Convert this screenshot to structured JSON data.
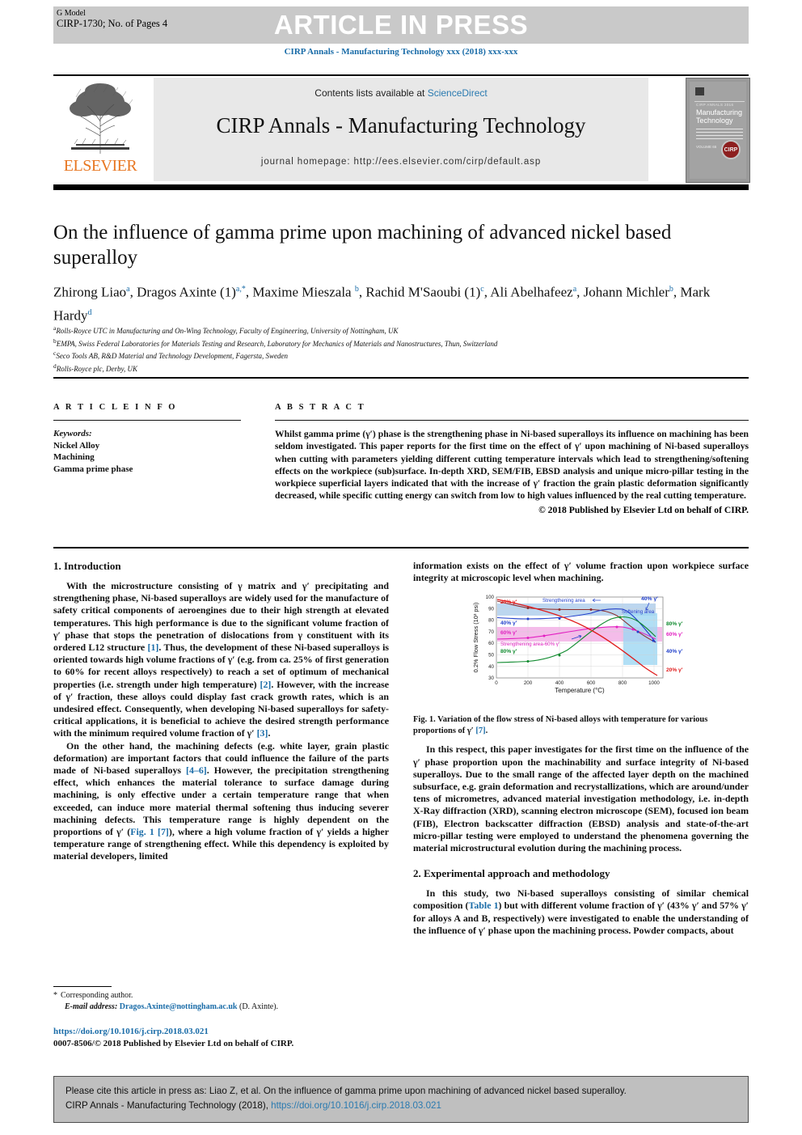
{
  "banner": {
    "g_model": "G Model",
    "article_id": "CIRP-1730; No. of Pages 4",
    "article_in_press": "ARTICLE IN PRESS",
    "journal_ref": "CIRP Annals - Manufacturing Technology xxx (2018) xxx-xxx"
  },
  "masthead": {
    "contents_prefix": "Contents lists available at ",
    "contents_link": "ScienceDirect",
    "journal_title": "CIRP Annals - Manufacturing Technology",
    "homepage": "journal homepage: http://ees.elsevier.com/cirp/default.asp",
    "publisher": "ELSEVIER",
    "cover": {
      "series": "CIRP ANNALS 2016",
      "title_line1": "Manufacturing",
      "title_line2": "Technology",
      "volume": "VOLUME 65",
      "logo": "CIRP"
    }
  },
  "article": {
    "title": "On the influence of gamma prime upon machining of advanced nickel based superalloy",
    "authors_html": "Zhirong Liao<sup>a</sup>, Dragos Axinte (1)<sup>a,*</sup>, Maxime Mieszala <sup>b</sup>, Rachid M'Saoubi (1)<sup>c</sup>, Ali Abelhafeez<sup>a</sup>, Johann Michler<sup>b</sup>, Mark Hardy<sup>d</sup>",
    "affiliations": [
      {
        "mark": "a",
        "text": "Rolls-Royce UTC in Manufacturing and On-Wing Technology, Faculty of Engineering, University of Nottingham, UK"
      },
      {
        "mark": "b",
        "text": "EMPA, Swiss Federal Laboratories for Materials Testing and Research, Laboratory for Mechanics of Materials and Nanostructures, Thun, Switzerland"
      },
      {
        "mark": "c",
        "text": "Seco Tools AB, R&D Material and Technology Development, Fagersta, Sweden"
      },
      {
        "mark": "d",
        "text": "Rolls-Royce plc, Derby, UK"
      }
    ]
  },
  "article_info": {
    "heading": "A R T I C L E   I N F O",
    "keywords_label": "Keywords:",
    "keywords": [
      "Nickel Alloy",
      "Machining",
      "Gamma prime phase"
    ]
  },
  "abstract": {
    "heading": "A B S T R A C T",
    "text": "Whilst gamma prime (γ′) phase is the strengthening phase in Ni-based superalloys its influence on machining has been seldom investigated. This paper reports for the first time on the effect of γ′ upon machining of Ni-based superalloys when cutting with parameters yielding different cutting temperature intervals which lead to strengthening/softening effects on the workpiece (sub)surface. In-depth XRD, SEM/FIB, EBSD analysis and unique micro-pillar testing in the workpiece superficial layers indicated that with the increase of γ′ fraction the grain plastic deformation significantly decreased, while specific cutting energy can switch from low to high values influenced by the real cutting temperature.",
    "copyright": "© 2018 Published by Elsevier Ltd on behalf of CIRP."
  },
  "sections": {
    "intro_heading": "1. Introduction",
    "intro_p1_a": "With the microstructure consisting of γ matrix and γ′ precipitating and strengthening phase, Ni-based superalloys are widely used for the manufacture of safety critical components of aeroengines due to their high strength at elevated temperatures. This high performance is due to the significant volume fraction of γ′ phase that stops the penetration of dislocations from γ constituent with its ordered L12 structure ",
    "intro_p1_ref1": "[1]",
    "intro_p1_b": ". Thus, the development of these Ni-based superalloys is oriented towards high volume fractions of γ′ (e.g. from ca. 25% of first generation to 60% for recent alloys respectively) to reach a set of optimum of mechanical properties (i.e. strength under high temperature) ",
    "intro_p1_ref2": "[2]",
    "intro_p1_c": ". However, with the increase of γ′ fraction, these alloys could display fast crack growth rates, which is an undesired effect. Consequently, when developing Ni-based superalloys for safety-critical applications, it is beneficial to achieve the desired strength performance with the minimum required volume fraction of γ′ ",
    "intro_p1_ref3": "[3]",
    "intro_p1_d": ".",
    "intro_p2_a": "On the other hand, the machining defects (e.g. white layer, grain plastic deformation) are important factors that could influence the failure of the parts made of Ni-based superalloys ",
    "intro_p2_ref1": "[4–6]",
    "intro_p2_b": ". However, the precipitation strengthening effect, which enhances the material tolerance to surface damage during machining, is only effective under a certain temperature range that when exceeded, can induce more material thermal softening thus inducing severer machining defects. This temperature range is highly dependent on the proportions of γ′ (",
    "intro_p2_ref2": "Fig. 1 [7]",
    "intro_p2_c": "), where a high volume fraction of γ′ yields a higher temperature range of strengthening effect. While this dependency is exploited by material developers, limited",
    "right_cont": "information exists on the effect of γ′ volume fraction upon workpiece surface integrity at microscopic level when machining.",
    "fig1_caption_a": "Fig. 1. ",
    "fig1_caption_b": "Variation of the flow stress of Ni-based alloys with temperature for various proportions of γ′ ",
    "fig1_caption_ref": "[7]",
    "fig1_caption_c": ".",
    "respect_p": "In this respect, this paper investigates for the first time on the influence of the γ′ phase proportion upon the machinability and surface integrity of Ni-based superalloys. Due to the small range of the affected layer depth on the machined subsurface, e.g. grain deformation and recrystallizations, which are around/under tens of micrometres, advanced material investigation methodology, i.e. in-depth X-Ray diffraction (XRD), scanning electron microscope (SEM), focused ion beam (FIB), Electron backscatter diffraction (EBSD) analysis and state-of-the-art micro-pillar testing were employed to understand the phenomena governing the material microstructural evolution during the machining process.",
    "exp_heading": "2. Experimental approach and methodology",
    "exp_p_a": "In this study, two Ni-based superalloys consisting of similar chemical composition (",
    "exp_p_ref": "Table 1",
    "exp_p_b": ") but with different volume fraction of γ′ (43% γ′ and 57% γ′ for alloys A and B, respectively) were investigated to enable the understanding of the influence of γ′ phase upon the machining process. Powder compacts, about"
  },
  "footnote": {
    "star": "*",
    "corresponding": "Corresponding author.",
    "email_label": "E-mail address:",
    "email": "Dragos.Axinte@nottingham.ac.uk",
    "email_suffix": "(D. Axinte).",
    "doi": "https://doi.org/10.1016/j.cirp.2018.03.021",
    "issn_line": "0007-8506/© 2018 Published by Elsevier Ltd on behalf of CIRP."
  },
  "cite_box": {
    "line1": "Please cite this article in press as: Liao Z, et al. On the influence of gamma prime upon machining of advanced nickel based superalloy.",
    "line2_prefix": "CIRP Annals - Manufacturing Technology (2018), ",
    "line2_link": "https://doi.org/10.1016/j.cirp.2018.03.021"
  },
  "colors": {
    "link": "#1a6ca8",
    "elsevier_orange": "#e87722",
    "banner_grey": "#c9c9c9",
    "cite_grey": "#bfbfbf"
  },
  "chart_data": {
    "type": "line",
    "title": "",
    "xlabel": "Temperature (°C)",
    "ylabel": "0.2% Flow Stress (10³ psi)",
    "xlim": [
      0,
      1050
    ],
    "ylim": [
      30,
      100
    ],
    "xticks": [
      0,
      200,
      400,
      600,
      800,
      1000
    ],
    "yticks": [
      30,
      40,
      50,
      60,
      70,
      80,
      90,
      100
    ],
    "grid": true,
    "legend_position": "right-inline",
    "annotations": [
      {
        "text": "20% γ′",
        "color": "#e01b1b",
        "role": "curve-label-left"
      },
      {
        "text": "40% γ′",
        "color": "#1f3ecb",
        "role": "curve-label-left"
      },
      {
        "text": "60% γ′",
        "color": "#e21fc1",
        "role": "curve-label-left"
      },
      {
        "text": "80% γ′",
        "color": "#0f8a2e",
        "role": "curve-label-left"
      },
      {
        "text": "Strengthening area",
        "color": "#1f3ecb",
        "role": "band-label"
      },
      {
        "text": "Softening area",
        "color": "#1f3ecb",
        "role": "band-label"
      },
      {
        "text": "Strengthening area-60% γ′",
        "color": "#e21fc1",
        "role": "band-label"
      },
      {
        "text": "40% γ′",
        "color": "#1f3ecb",
        "role": "arrow-label"
      }
    ],
    "right_labels": [
      {
        "text": "80% γ′",
        "color": "#0f8a2e"
      },
      {
        "text": "60% γ′",
        "color": "#e21fc1"
      },
      {
        "text": "40% γ′",
        "color": "#1f3ecb"
      },
      {
        "text": "20% γ′",
        "color": "#e01b1b"
      }
    ],
    "series": [
      {
        "name": "20% γ′",
        "color": "#8c2b2b",
        "x": [
          0,
          100,
          200,
          300,
          400,
          500,
          600,
          700,
          800,
          900,
          1000
        ],
        "y": [
          96,
          92,
          89,
          88,
          88,
          88,
          88,
          86,
          78,
          66,
          58
        ]
      },
      {
        "name": "40% γ′",
        "color": "#1f3ecb",
        "x": [
          0,
          100,
          200,
          300,
          400,
          500,
          600,
          700,
          800,
          900,
          1000
        ],
        "y": [
          82,
          81,
          81,
          80,
          81,
          81,
          84,
          88,
          87,
          70,
          52
        ]
      },
      {
        "name": "60% γ′",
        "color": "#e21fc1",
        "x": [
          0,
          100,
          200,
          300,
          400,
          500,
          600,
          700,
          800,
          900,
          1000
        ],
        "y": [
          63,
          64,
          64,
          65,
          66,
          68,
          70,
          72,
          74,
          72,
          64
        ]
      },
      {
        "name": "80% γ′",
        "color": "#0f8a2e",
        "x": [
          0,
          100,
          200,
          300,
          400,
          500,
          600,
          700,
          800,
          900,
          1000
        ],
        "y": [
          43,
          44,
          44,
          45,
          46,
          49,
          56,
          68,
          79,
          80,
          70
        ]
      },
      {
        "name": "20% γ′ falling",
        "color": "#e01b1b",
        "x": [
          0,
          200,
          400,
          600,
          700,
          800,
          900,
          1000
        ],
        "y": [
          99,
          95,
          90,
          83,
          76,
          64,
          48,
          33
        ]
      }
    ],
    "bands": [
      {
        "label": "Strengthening area (blue)",
        "color": "#bcd6ef",
        "x_range": [
          30,
          880
        ],
        "y_range": [
          80,
          90
        ]
      },
      {
        "label": "Strengthening area-60% γ′ (magenta)",
        "color": "#f4bce9",
        "x_range": [
          30,
          1020
        ],
        "y_range": [
          63,
          75
        ]
      },
      {
        "label": "Softening area (light blue)",
        "color": "#9ed7f2",
        "x_range": [
          800,
          980
        ],
        "y_range": [
          45,
          82
        ]
      }
    ]
  }
}
